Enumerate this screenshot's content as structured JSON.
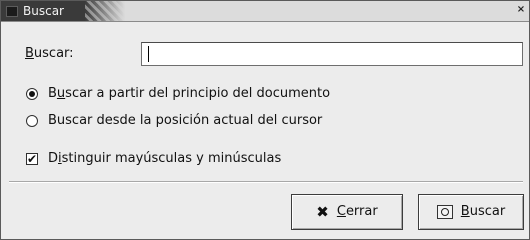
{
  "window": {
    "title": "Buscar",
    "close_glyph": "×"
  },
  "search": {
    "label_mnemonic": "B",
    "label_rest": "uscar:",
    "value": "",
    "placeholder": ""
  },
  "options": {
    "radio_start": {
      "selected": true,
      "label_pre": "B",
      "label_mnemonic": "u",
      "label_rest": "scar a partir del principio del documento"
    },
    "radio_cursor": {
      "selected": false,
      "label": "Buscar desde la posición actual del cursor"
    },
    "match_case": {
      "checked": true,
      "mark": "✔",
      "label_pre": "D",
      "label_mnemonic": "i",
      "label_rest": "stinguir mayúsculas y minúsculas"
    }
  },
  "buttons": {
    "close": {
      "icon": "close-x-icon",
      "glyph": "✖",
      "mnemonic": "C",
      "rest": "errar"
    },
    "find": {
      "icon": "find-icon",
      "mnemonic": "B",
      "rest": "uscar"
    }
  },
  "colors": {
    "title_tab": "#3a3a3a",
    "dialog_bg": "#ececec"
  }
}
